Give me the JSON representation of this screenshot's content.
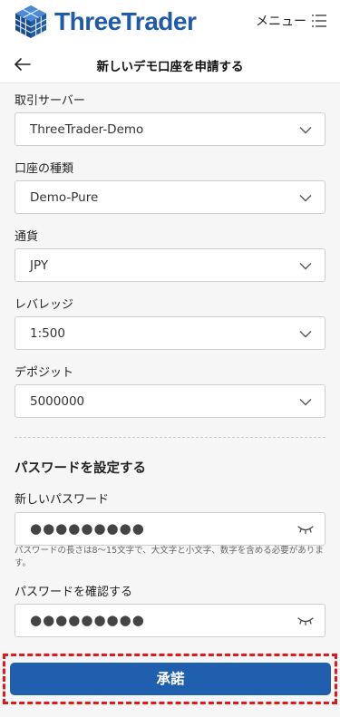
{
  "header": {
    "brand": "ThreeTrader",
    "menu_label": "メニュー",
    "brand_color": "#1e5ba8"
  },
  "titlebar": {
    "title": "新しいデモ口座を申請する",
    "back_icon": "arrow-left-icon"
  },
  "form": {
    "fields": [
      {
        "label": "取引サーバー",
        "value": "ThreeTrader-Demo"
      },
      {
        "label": "口座の種類",
        "value": "Demo-Pure"
      },
      {
        "label": "通貨",
        "value": "JPY"
      },
      {
        "label": "レバレッジ",
        "value": "1:500"
      },
      {
        "label": "デポジット",
        "value": "5000000"
      }
    ],
    "password_section": {
      "title": "パスワードを設定する",
      "new_password_label": "新しいパスワード",
      "new_password_value": "●●●●●●●●●",
      "hint": "パスワードの長さは8～15文字で、大文字と小文字、数字を含める必要があります。",
      "confirm_label": "パスワードを確認する",
      "confirm_value": "●●●●●●●●●"
    }
  },
  "submit": {
    "label": "承諾",
    "color": "#1f5fad",
    "highlight_color": "#e0191b"
  }
}
